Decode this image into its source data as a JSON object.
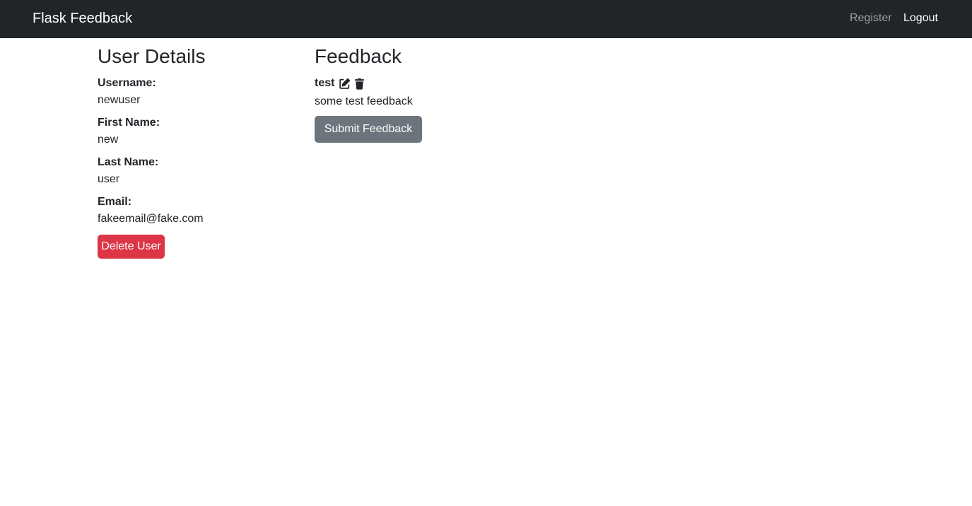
{
  "navbar": {
    "brand": "Flask Feedback",
    "links": [
      {
        "label": "Register"
      },
      {
        "label": "Logout"
      }
    ]
  },
  "user_details": {
    "heading": "User Details",
    "fields": [
      {
        "label": "Username:",
        "value": "newuser"
      },
      {
        "label": "First Name:",
        "value": "new"
      },
      {
        "label": "Last Name:",
        "value": "user"
      },
      {
        "label": "Email:",
        "value": "fakeemail@fake.com"
      }
    ],
    "delete_button": "Delete User"
  },
  "feedback": {
    "heading": "Feedback",
    "items": [
      {
        "title": "test",
        "content": "some test feedback",
        "edit_icon": "edit-icon",
        "delete_icon": "trash-icon"
      }
    ],
    "submit_button": "Submit Feedback"
  },
  "colors": {
    "navbar_bg": "#212529",
    "danger": "#dc3545",
    "secondary": "#6c757d"
  }
}
